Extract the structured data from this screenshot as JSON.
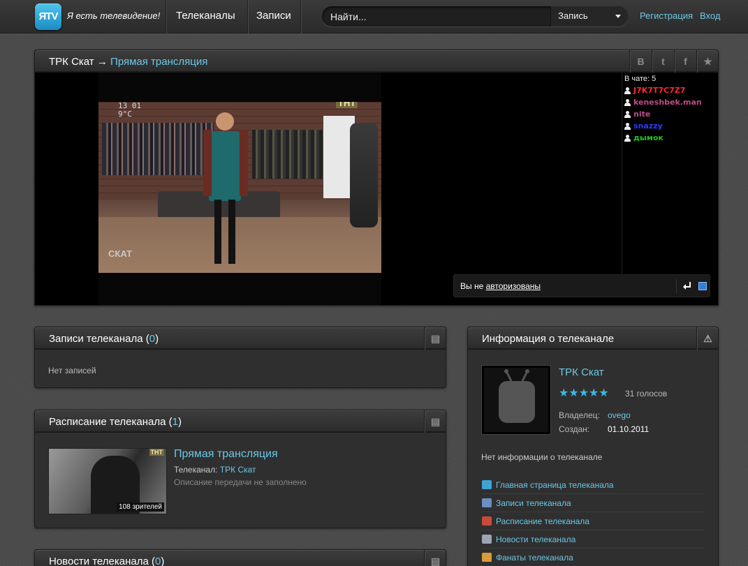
{
  "header": {
    "logo_text": "ЯTV",
    "slogan": "Я есть телевидение!",
    "nav": [
      "Телеканалы",
      "Записи"
    ],
    "search_placeholder": "Найти...",
    "search_type": "Запись",
    "register": "Регистрация",
    "login": "Вход"
  },
  "player_panel": {
    "channel": "ТРК Скат",
    "arrow": "→",
    "section": "Прямая трансляция",
    "share_buttons": [
      "B",
      "t",
      "f",
      "★"
    ],
    "video": {
      "logo_tl": "13 01\n9°C",
      "logo_tr": "ТНТ",
      "logo_bl": "СКАТ"
    },
    "chat": {
      "count_label": "В чате: 5",
      "users": [
        {
          "name": "J7K7T7C7Z7",
          "color": "#ff2a2a"
        },
        {
          "name": "keneshbek.man",
          "color": "#c04a88"
        },
        {
          "name": "nite",
          "color": "#c04a88"
        },
        {
          "name": "snazzy",
          "color": "#2a3cff"
        },
        {
          "name": "дымок",
          "color": "#20c020"
        }
      ],
      "input_prefix": "Вы не ",
      "input_link": "авторизованы"
    }
  },
  "records_panel": {
    "title": "Записи телеканала",
    "count": "0",
    "empty": "Нет записей"
  },
  "schedule_panel": {
    "title": "Расписание телеканала",
    "count": "1",
    "item": {
      "title": "Прямая трансляция",
      "channel_label": "Телеканал:",
      "channel": "ТРК Скат",
      "description": "Описание передачи не заполнено",
      "viewers": "108 зрителей",
      "thumb_logo": "ТНТ"
    }
  },
  "news_panel": {
    "title": "Новости телеканала",
    "count": "0"
  },
  "info_panel": {
    "title": "Информация о телеканале",
    "name": "ТРК Скат",
    "rating": 5,
    "votes": "31 голосов",
    "owner_label": "Владелец:",
    "owner": "ovego",
    "created_label": "Создан:",
    "created": "01.10.2011",
    "no_info": "Нет информации о телеканале",
    "links": [
      {
        "label": "Главная страница телеканала",
        "icon": "tv-icon",
        "color": "#3fa3d6"
      },
      {
        "label": "Записи телеканала",
        "icon": "film-icon",
        "color": "#6a8fc0"
      },
      {
        "label": "Расписание телеканала",
        "icon": "calendar-icon",
        "color": "#c84a3a"
      },
      {
        "label": "Новости телеканала",
        "icon": "news-icon",
        "color": "#9aa6b2"
      },
      {
        "label": "Фанаты телеканала",
        "icon": "users-icon",
        "color": "#d89a3a"
      }
    ]
  }
}
